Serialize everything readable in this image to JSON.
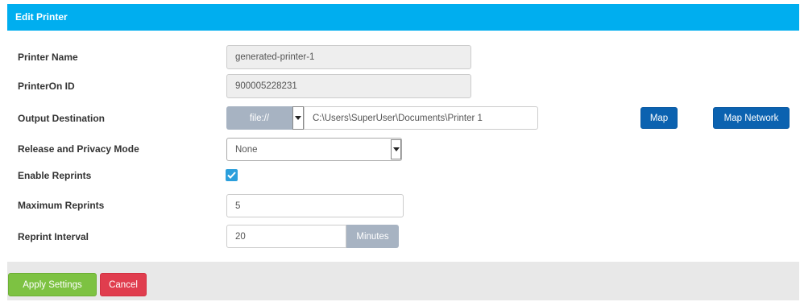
{
  "header": {
    "title": "Edit Printer"
  },
  "form": {
    "printer_name": {
      "label": "Printer Name",
      "value": "generated-printer-1"
    },
    "printeron_id": {
      "label": "PrinterOn ID",
      "value": "900005228231"
    },
    "output_destination": {
      "label": "Output Destination",
      "protocol": "file://",
      "path": "C:\\Users\\SuperUser\\Documents\\Printer 1",
      "map_label": "Map",
      "map_network_label": "Map Network"
    },
    "release_privacy_mode": {
      "label": "Release and Privacy Mode",
      "value": "None"
    },
    "enable_reprints": {
      "label": "Enable Reprints",
      "checked": true
    },
    "maximum_reprints": {
      "label": "Maximum Reprints",
      "value": "5"
    },
    "reprint_interval": {
      "label": "Reprint Interval",
      "value": "20",
      "unit": "Minutes"
    }
  },
  "footer": {
    "apply_label": "Apply Settings",
    "cancel_label": "Cancel"
  },
  "colors": {
    "header": "#00aeef",
    "primary": "#0b62b0",
    "apply": "#7dc242",
    "cancel": "#e03d4e",
    "checkbox": "#2b9fdc"
  }
}
